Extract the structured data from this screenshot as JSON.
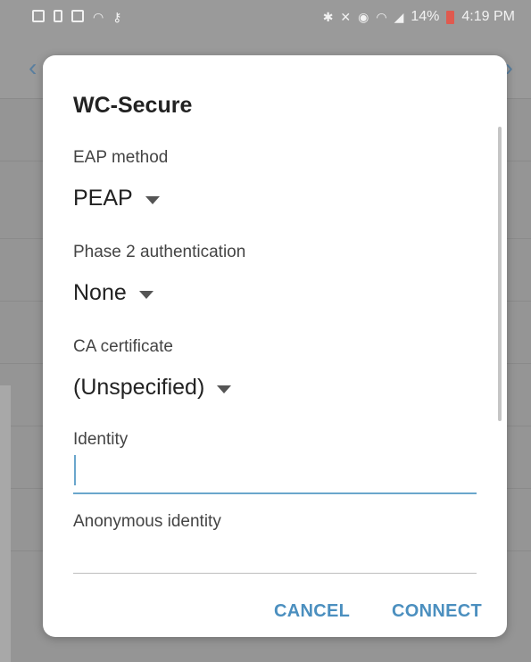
{
  "status_bar": {
    "battery_percent": "14%",
    "time": "4:19 PM",
    "left_icons": [
      "message-icon",
      "alert-icon",
      "image-icon",
      "wifi-icon",
      "key-icon"
    ],
    "right_icons": [
      "bluetooth-icon",
      "mute-icon",
      "alarm-icon",
      "wifi-icon",
      "signal-icon"
    ]
  },
  "dialog": {
    "title": "WC-Secure",
    "eap_method": {
      "label": "EAP method",
      "value": "PEAP"
    },
    "phase2": {
      "label": "Phase 2 authentication",
      "value": "None"
    },
    "ca_certificate": {
      "label": "CA certificate",
      "value": "(Unspecified)"
    },
    "identity": {
      "label": "Identity",
      "value": ""
    },
    "anonymous_identity": {
      "label": "Anonymous identity",
      "value": ""
    },
    "buttons": {
      "cancel": "CANCEL",
      "connect": "CONNECT"
    }
  },
  "colors": {
    "accent": "#4b8fbf",
    "focus_line": "#6aa6cc",
    "battery_low": "#e05a4f",
    "scrim": "#8f8f8f"
  }
}
